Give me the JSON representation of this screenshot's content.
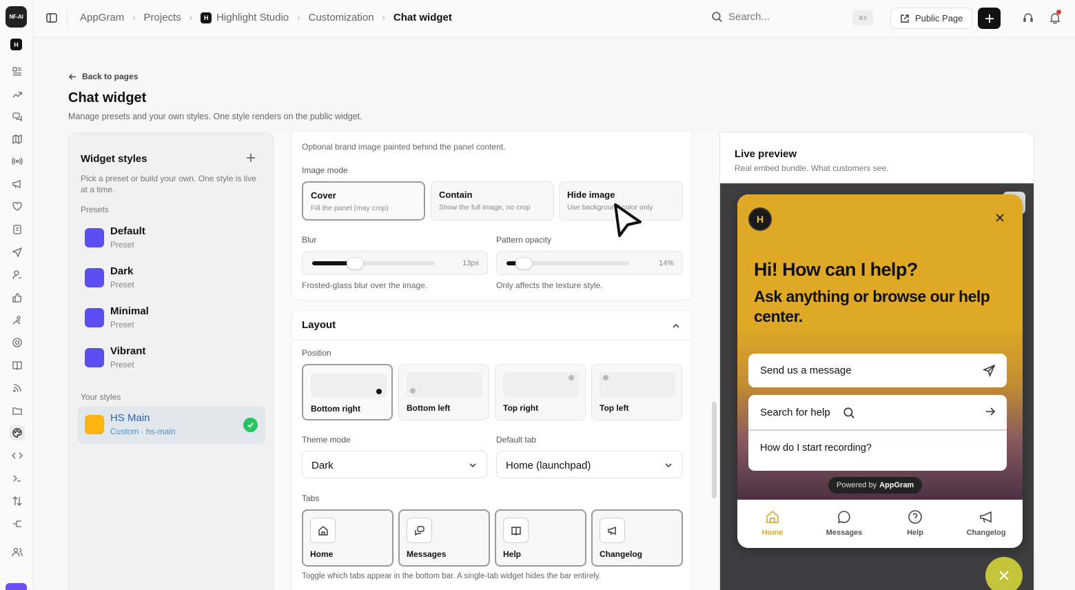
{
  "rail": {
    "logo": "NF-AI",
    "workspace": "H"
  },
  "topbar": {
    "breadcrumbs": [
      "AppGram",
      "Projects",
      "Highlight Studio",
      "Customization",
      "Chat widget"
    ],
    "project_badge": "H",
    "search_placeholder": "Search...",
    "search_shortcut": "⌘K",
    "public_page": "Public Page"
  },
  "page": {
    "back": "Back to pages",
    "title": "Chat widget",
    "subtitle": "Manage presets and your own styles. One style renders on the public widget."
  },
  "styles": {
    "title": "Widget styles",
    "description": "Pick a preset or build your own. One style is live at a time.",
    "presets_label": "Presets",
    "presets": [
      {
        "name": "Default",
        "sub": "Preset",
        "color": "#5b4ff2"
      },
      {
        "name": "Dark",
        "sub": "Preset",
        "color": "#5b4ff2"
      },
      {
        "name": "Minimal",
        "sub": "Preset",
        "color": "#5b4ff2"
      },
      {
        "name": "Vibrant",
        "sub": "Preset",
        "color": "#5b4ff2"
      }
    ],
    "your_label": "Your styles",
    "custom": [
      {
        "name": "HS Main",
        "sub": "Custom · hs-main",
        "color": "#fbb414"
      }
    ]
  },
  "background": {
    "image_hint": "Optional brand image painted behind the panel content.",
    "image_mode_label": "Image mode",
    "modes": [
      {
        "title": "Cover",
        "sub": "Fill the panel (may crop)"
      },
      {
        "title": "Contain",
        "sub": "Show the full image, no crop"
      },
      {
        "title": "Hide image",
        "sub": "Use background color only"
      }
    ],
    "selected_mode": "Cover",
    "blur_label": "Blur",
    "blur_value": "13px",
    "blur_level": 0.35,
    "blur_hint": "Frosted-glass blur over the image.",
    "pattern_label": "Pattern opacity",
    "pattern_value": "14%",
    "pattern_level": 0.14,
    "pattern_hint": "Only affects the texture style."
  },
  "layout": {
    "title": "Layout",
    "position_label": "Position",
    "positions": [
      "Bottom right",
      "Bottom left",
      "Top right",
      "Top left"
    ],
    "selected_position": "Bottom right",
    "theme_label": "Theme mode",
    "theme_value": "Dark",
    "default_tab_label": "Default tab",
    "default_tab_value": "Home (launchpad)",
    "tabs_label": "Tabs",
    "tabs": [
      "Home",
      "Messages",
      "Help",
      "Changelog"
    ],
    "tabs_hint": "Toggle which tabs appear in the bottom bar. A single-tab widget hides the bar entirely."
  },
  "preview": {
    "title": "Live preview",
    "subtitle": "Real embed bundle. What customers see.",
    "widget": {
      "logo": "H",
      "heading": "Hi! How can I help?",
      "subheading": "Ask anything or browse our help center.",
      "send_message": "Send us a message",
      "search_help": "Search for help",
      "question": "How do I start recording?",
      "powered_by": "Powered by",
      "brand": "AppGram",
      "nav": [
        "Home",
        "Messages",
        "Help",
        "Changelog"
      ],
      "active_nav": "Home",
      "accent": "#e0a925"
    }
  }
}
